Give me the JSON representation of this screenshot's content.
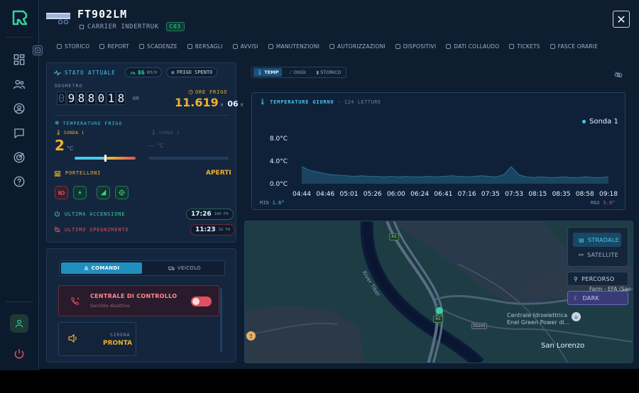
{
  "header": {
    "plate": "FT902LM",
    "subtitle": "CARRIER INDERTRUK",
    "badge": "C03",
    "close_label": "✕"
  },
  "tabs": [
    {
      "label": "STORICO",
      "icon": "history-icon"
    },
    {
      "label": "REPORT",
      "icon": "report-icon"
    },
    {
      "label": "SCADENZE",
      "icon": "calendar-icon"
    },
    {
      "label": "BERSAGLI",
      "icon": "target-icon"
    },
    {
      "label": "AVVISI",
      "icon": "bell-icon"
    },
    {
      "label": "MANUTENZIONI",
      "icon": "wrench-icon"
    },
    {
      "label": "AUTORIZZAZIONI",
      "icon": "users-icon"
    },
    {
      "label": "DISPOSITIVI",
      "icon": "device-icon"
    },
    {
      "label": "DATI COLLAUDO",
      "icon": "clipboard-icon"
    },
    {
      "label": "TICKETS",
      "icon": "tag-icon"
    },
    {
      "label": "FASCE ORARIE",
      "icon": "clock-icon"
    }
  ],
  "status": {
    "title": "STATO ATTUALE",
    "speed_value": "86",
    "speed_unit": "KM/H",
    "frigo_state": "FRIGO SPENTO",
    "odometer_label": "ODOMETRO",
    "odometer_digits": [
      "0",
      "9",
      "8",
      "8",
      "0",
      "1",
      "8"
    ],
    "odometer_unit": "KM",
    "ore_label": "ORE FRIGO",
    "ore_hours": "11.619",
    "ore_h_unit": "H",
    "ore_minutes": "06",
    "ore_m_unit": "M",
    "temp_title": "TEMPERATURE FRIGO",
    "sonda1_label": "SONDA 1",
    "sonda1_value": "2",
    "sonda1_unit": "°C",
    "sonda1_level": 0.5,
    "sonda2_label": "SONDA 2",
    "sonda2_value": "—",
    "sonda2_unit": "°C",
    "doors_label": "PORTELLONI",
    "doors_state": "APERTI",
    "last_on_label": "ULTIMA ACCENSIONE",
    "last_on_time": "17:26",
    "last_on_ago": "16H FA",
    "last_off_label": "ULTIMO SPEGNIMENTO",
    "last_off_time": "11:23",
    "last_off_ago": "1G FA"
  },
  "commands": {
    "tab_commands": "COMANDI",
    "tab_vehicle": "VEICOLO",
    "control_title": "CENTRALE DI CONTROLLO",
    "control_sub": "Servizio disattivo",
    "siren_label": "SIRENA",
    "siren_state": "PRONTA"
  },
  "chart_tabs": {
    "temp": "TEMP",
    "today": "OGGI",
    "history": "STORICO"
  },
  "chart_data": {
    "type": "area",
    "title": "TEMPERATURE GIORNO",
    "subtitle": "· 124 LETTURE",
    "legend": "Sonda 1",
    "y_ticks": [
      "8.0°C",
      "4.0°C",
      "0.0°C"
    ],
    "ylim": [
      0,
      8
    ],
    "x": [
      "04:44",
      "04:46",
      "05:01",
      "05:26",
      "06:00",
      "06:24",
      "06:41",
      "07:16",
      "07:35",
      "07:53",
      "08:15",
      "08:35",
      "08:58",
      "09:18"
    ],
    "series": [
      {
        "name": "Sonda 1",
        "values": [
          3.0,
          2.4,
          2.1,
          1.8,
          1.6,
          1.5,
          1.4,
          1.3,
          1.4,
          1.3,
          1.3,
          1.2,
          1.3,
          1.2,
          1.3,
          1.2,
          1.2,
          1.3,
          1.2,
          1.3,
          1.4,
          1.3,
          1.2,
          1.3,
          1.4,
          1.3,
          1.2,
          1.6,
          3.0,
          1.6,
          1.2,
          1.1,
          1.2,
          1.1,
          1.1,
          1.2,
          1.1,
          1.1,
          1.2,
          1.1,
          1.1,
          1.2
        ]
      }
    ],
    "min_label": "MIN",
    "min_value": "1.6°",
    "max_label": "MAX",
    "max_value": "5.6°",
    "color": "#46c9ef"
  },
  "map": {
    "stradale": "STRADALE",
    "satellite": "SATELLITE",
    "percorso": "PERCORSO",
    "dark": "DARK",
    "river": "River Tiber",
    "a1_top": "A1",
    "a1_bottom": "A1",
    "ss205": "SS205",
    "place1": "Centrale Idroelettrica",
    "place2": "Enel Green Power di...",
    "place3": "San Lorenzo",
    "farm": "Farm - EFA (Sac"
  },
  "colors": {
    "accent": "#46c9ef",
    "warning": "#f0b030",
    "danger": "#e05060",
    "ok": "#33d39a"
  }
}
